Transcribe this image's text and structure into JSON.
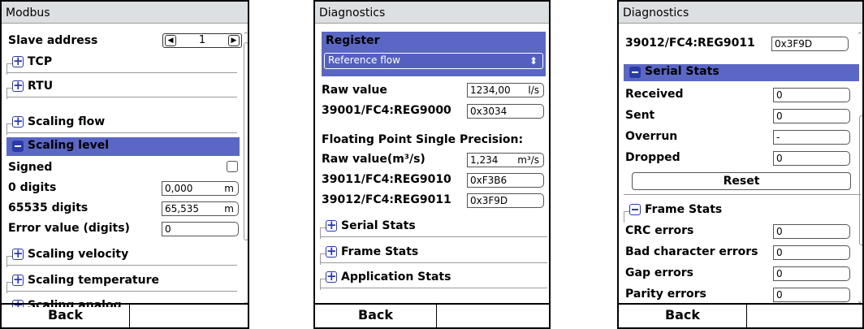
{
  "modbus": {
    "title": "Modbus",
    "slave_address_label": "Slave address",
    "slave_address_value": "1",
    "sections": {
      "tcp": "TCP",
      "rtu": "RTU",
      "scaling_flow": "Scaling flow",
      "scaling_level": "Scaling level",
      "scaling_velocity": "Scaling velocity",
      "scaling_temperature": "Scaling temperature",
      "scaling_analog": "Scaling analog"
    },
    "signed_label": "Signed",
    "zero_digits_label": "0 digits",
    "zero_digits_value": "0,000",
    "zero_digits_unit": "m",
    "max_digits_label": "65535 digits",
    "max_digits_value": "65,535",
    "max_digits_unit": "m",
    "error_value_label": "Error value (digits)",
    "error_value_value": "0",
    "back_label": "Back"
  },
  "diag1": {
    "title": "Diagnostics",
    "register_label": "Register",
    "register_value": "Reference flow",
    "raw_value_label": "Raw value",
    "raw_value_value": "1234,00",
    "raw_value_unit": "l/s",
    "reg9000_label": "39001/FC4:REG9000",
    "reg9000_value": "0x3034",
    "fp_label": "Floating Point Single Precision:",
    "raw_value_m3_label": "Raw value(m³/s)",
    "raw_value_m3_value": "1,234",
    "raw_value_m3_unit": "m³/s",
    "reg9010_label": "39011/FC4:REG9010",
    "reg9010_value": "0xF3B6",
    "reg9011_label": "39012/FC4:REG9011",
    "reg9011_value": "0x3F9D",
    "serial_stats": "Serial Stats",
    "frame_stats": "Frame Stats",
    "application_stats": "Application Stats",
    "back_label": "Back"
  },
  "diag2": {
    "title": "Diagnostics",
    "reg9011_label": "39012/FC4:REG9011",
    "reg9011_value": "0x3F9D",
    "serial_stats": "Serial Stats",
    "received_label": "Received",
    "received_value": "0",
    "sent_label": "Sent",
    "sent_value": "0",
    "overrun_label": "Overrun",
    "overrun_value": "-",
    "dropped_label": "Dropped",
    "dropped_value": "0",
    "reset_label": "Reset",
    "frame_stats": "Frame Stats",
    "crc_label": "CRC errors",
    "crc_value": "0",
    "bad_char_label": "Bad character errors",
    "bad_char_value": "0",
    "gap_label": "Gap errors",
    "gap_value": "0",
    "parity_label": "Parity errors",
    "parity_value": "0",
    "back_label": "Back"
  },
  "colors": {
    "highlight": "#5b67c4",
    "icon": "#2a3aa8",
    "titlebar": "#dde0e3"
  }
}
